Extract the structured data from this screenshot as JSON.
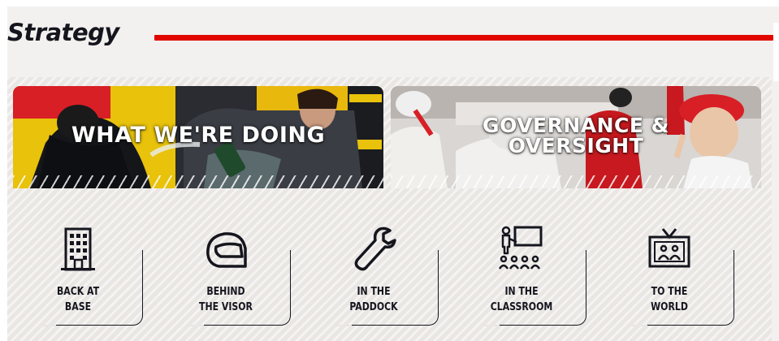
{
  "section": {
    "title": "Strategy",
    "accent_color": "#e10600"
  },
  "cards": [
    {
      "label": "WHAT WE'RE DOING"
    },
    {
      "label_line1": "GOVERNANCE &",
      "label_line2": "OVERSIGHT"
    }
  ],
  "tiles": [
    {
      "icon": "building-icon",
      "line1": "BACK AT",
      "line2": "BASE"
    },
    {
      "icon": "helmet-icon",
      "line1": "BEHIND",
      "line2": "THE VISOR"
    },
    {
      "icon": "wrench-icon",
      "line1": "IN THE",
      "line2": "PADDOCK"
    },
    {
      "icon": "classroom-icon",
      "line1": "IN THE",
      "line2": "CLASSROOM"
    },
    {
      "icon": "tv-icon",
      "line1": "TO THE",
      "line2": "WORLD"
    }
  ]
}
